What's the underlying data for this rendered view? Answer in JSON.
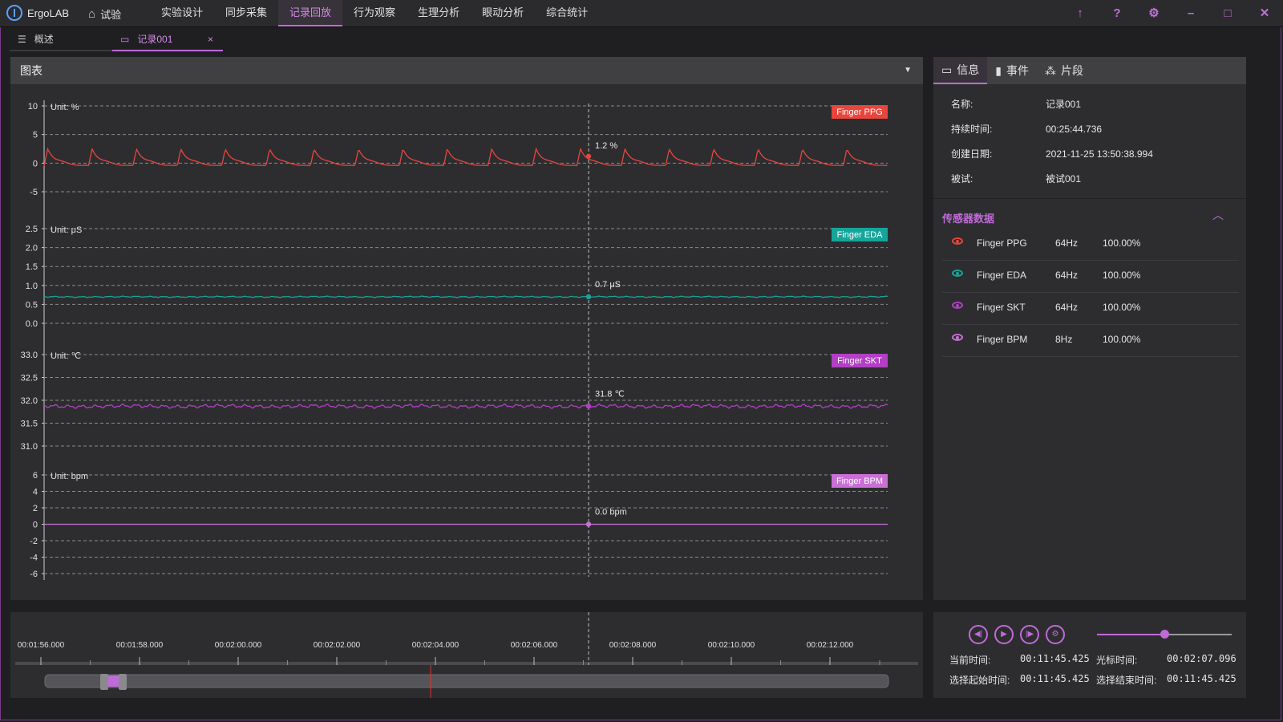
{
  "app": {
    "name": "ErgoLAB",
    "home_label": "试验"
  },
  "nav": [
    {
      "label": "实验设计",
      "active": false
    },
    {
      "label": "同步采集",
      "active": false
    },
    {
      "label": "记录回放",
      "active": true
    },
    {
      "label": "行为观察",
      "active": false
    },
    {
      "label": "生理分析",
      "active": false
    },
    {
      "label": "眼动分析",
      "active": false
    },
    {
      "label": "综合统计",
      "active": false
    }
  ],
  "window_buttons": [
    "upload-icon",
    "help-icon",
    "gear-icon",
    "minimize-icon",
    "maximize-icon",
    "close-icon"
  ],
  "tabs": [
    {
      "label": "概述",
      "icon": "list-icon",
      "active": false
    },
    {
      "label": "记录001",
      "icon": "monitor-icon",
      "active": true,
      "close": "×"
    }
  ],
  "chart_panel": {
    "title": "图表",
    "caret": "▼"
  },
  "chart_data": [
    {
      "type": "line",
      "series": [
        {
          "name": "Finger PPG",
          "color": "#e8453c"
        }
      ],
      "unit_label": "Unit: %",
      "y_ticks": [
        "10",
        "5",
        "0",
        "-5"
      ],
      "ylim": [
        -5,
        10
      ],
      "cursor_value": "1.2 %",
      "pattern": "periodic pulse, baseline ≈ -0.5, peaks ≈ 2.5",
      "beats": 19
    },
    {
      "type": "line",
      "series": [
        {
          "name": "Finger EDA",
          "color": "#16a59a"
        }
      ],
      "unit_label": "Unit: μS",
      "y_ticks": [
        "2.5",
        "2.0",
        "1.5",
        "1.0",
        "0.5",
        "0.0"
      ],
      "ylim": [
        0,
        2.5
      ],
      "cursor_value": "0.7 μS",
      "level": 0.7
    },
    {
      "type": "line",
      "series": [
        {
          "name": "Finger SKT",
          "color": "#b23fc4"
        }
      ],
      "unit_label": "Unit: ℃",
      "y_ticks": [
        "33.0",
        "32.5",
        "32.0",
        "31.5",
        "31.0"
      ],
      "ylim": [
        31.0,
        33.0
      ],
      "cursor_value": "31.8 ℃",
      "level": 31.87
    },
    {
      "type": "line",
      "series": [
        {
          "name": "Finger BPM",
          "color": "#c96fd6"
        }
      ],
      "unit_label": "Unit: bpm",
      "y_ticks": [
        "6",
        "4",
        "2",
        "0",
        "-2",
        "-4",
        "-6"
      ],
      "ylim": [
        -6,
        6
      ],
      "cursor_value": "0.0 bpm",
      "level": 0
    }
  ],
  "info_tabs": [
    {
      "label": "信息",
      "icon": "monitor-icon",
      "active": true
    },
    {
      "label": "事件",
      "icon": "marker-icon",
      "active": false
    },
    {
      "label": "片段",
      "icon": "segment-icon",
      "active": false
    }
  ],
  "info": [
    {
      "key": "名称:",
      "value": "记录001"
    },
    {
      "key": "持续时间:",
      "value": "00:25:44.736"
    },
    {
      "key": "创建日期:",
      "value": "2021-11-25 13:50:38.994"
    },
    {
      "key": "被试:",
      "value": "被试001"
    }
  ],
  "sensor_section": {
    "title": "传感器数据",
    "chevron": "︿"
  },
  "sensors": [
    {
      "name": "Finger PPG",
      "rate": "64Hz",
      "pct": "100.00%",
      "color": "#e8453c"
    },
    {
      "name": "Finger EDA",
      "rate": "64Hz",
      "pct": "100.00%",
      "color": "#16a59a"
    },
    {
      "name": "Finger SKT",
      "rate": "64Hz",
      "pct": "100.00%",
      "color": "#b23fc4"
    },
    {
      "name": "Finger BPM",
      "rate": "8Hz",
      "pct": "100.00%",
      "color": "#c96fd6"
    }
  ],
  "timeline": {
    "ticks": [
      "00:01:56.000",
      "00:01:58.000",
      "00:02:00.000",
      "00:02:02.000",
      "00:02:04.000",
      "00:02:06.000",
      "00:02:08.000",
      "00:02:10.000",
      "00:02:12.000"
    ]
  },
  "player": {
    "buttons": [
      "prev-icon",
      "play-icon",
      "next-icon",
      "gear-icon"
    ],
    "volume": 0.5,
    "current_time_label": "当前时间:",
    "current_time": "00:11:45.425",
    "cursor_time_label": "光标时间:",
    "cursor_time": "00:02:07.096",
    "sel_start_label": "选择起始时间:",
    "sel_start": "00:11:45.425",
    "sel_end_label": "选择结束时间:",
    "sel_end": "00:11:45.425"
  },
  "accent": "#c06ad8"
}
